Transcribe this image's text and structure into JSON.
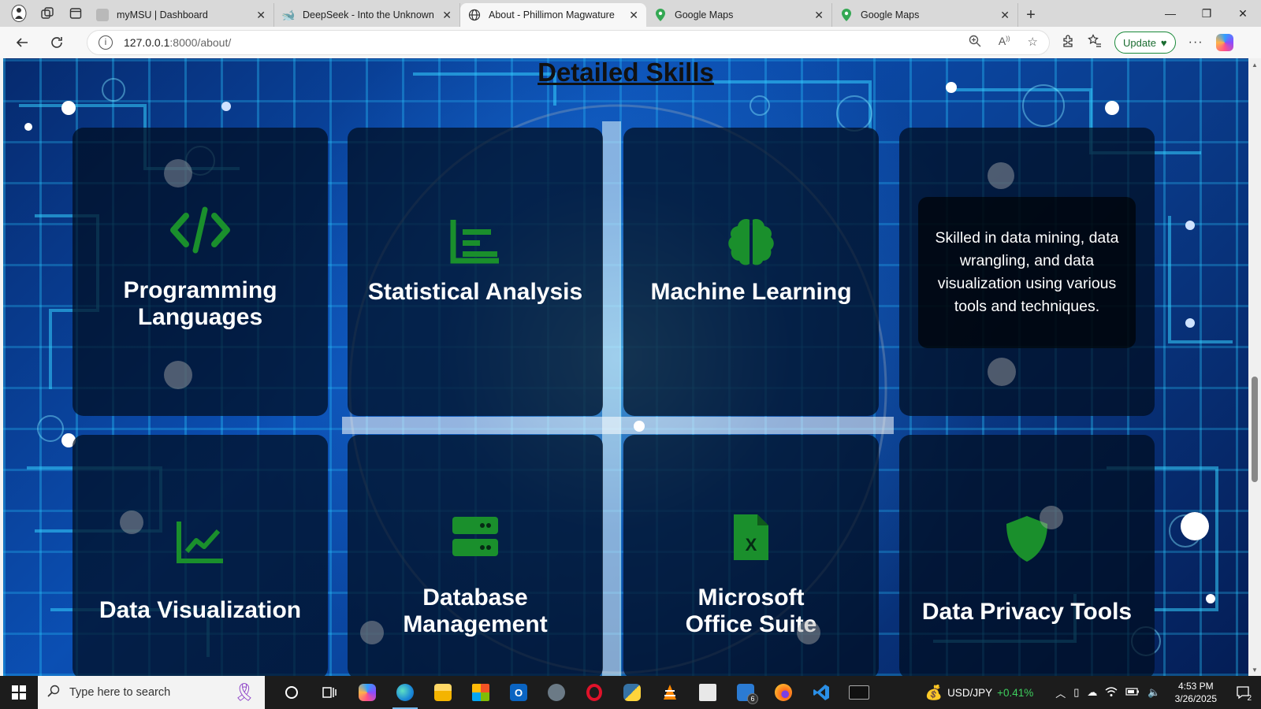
{
  "browser": {
    "tabs": [
      {
        "title": "myMSU | Dashboard",
        "favicon": "page-icon",
        "color": "#8a8a8a",
        "active": false
      },
      {
        "title": "DeepSeek - Into the Unknown",
        "favicon": "deepseek-icon",
        "color": "#4d6bfe",
        "active": false
      },
      {
        "title": "About - Phillimon Magwature",
        "favicon": "globe-icon",
        "color": "#333333",
        "active": true
      },
      {
        "title": "Google Maps",
        "favicon": "maps-pin-icon",
        "color": "#34a853",
        "active": false
      },
      {
        "title": "Google Maps",
        "favicon": "maps-pin-icon",
        "color": "#34a853",
        "active": false
      }
    ],
    "address": {
      "host": "127.0.0.1",
      "path": ":8000/about/"
    },
    "update_label": "Update"
  },
  "page": {
    "title": "Detailed Skills",
    "accent_green": "#1a8f2c",
    "cards": [
      {
        "label": "Programming Languages",
        "icon": "code-icon"
      },
      {
        "label": "Statistical Analysis",
        "icon": "chart-bar-icon"
      },
      {
        "label": "Machine Learning",
        "icon": "brain-icon"
      },
      {
        "label": "",
        "icon": "",
        "description": "Skilled in data mining, data wrangling, and data visualization using various tools and techniques."
      },
      {
        "label": "Data Visualization",
        "icon": "line-chart-icon"
      },
      {
        "label": "Database Management",
        "icon": "server-icon"
      },
      {
        "label": "Microsoft Office Suite",
        "icon": "excel-file-icon"
      },
      {
        "label": "Data Privacy Tools",
        "icon": "shield-icon"
      }
    ]
  },
  "taskbar": {
    "search_placeholder": "Type here to search",
    "ticker_symbol": "USD/JPY",
    "ticker_change": "+0.41%",
    "time": "4:53 PM",
    "date": "3/26/2025",
    "notifications": "2",
    "badge_count": "6"
  }
}
